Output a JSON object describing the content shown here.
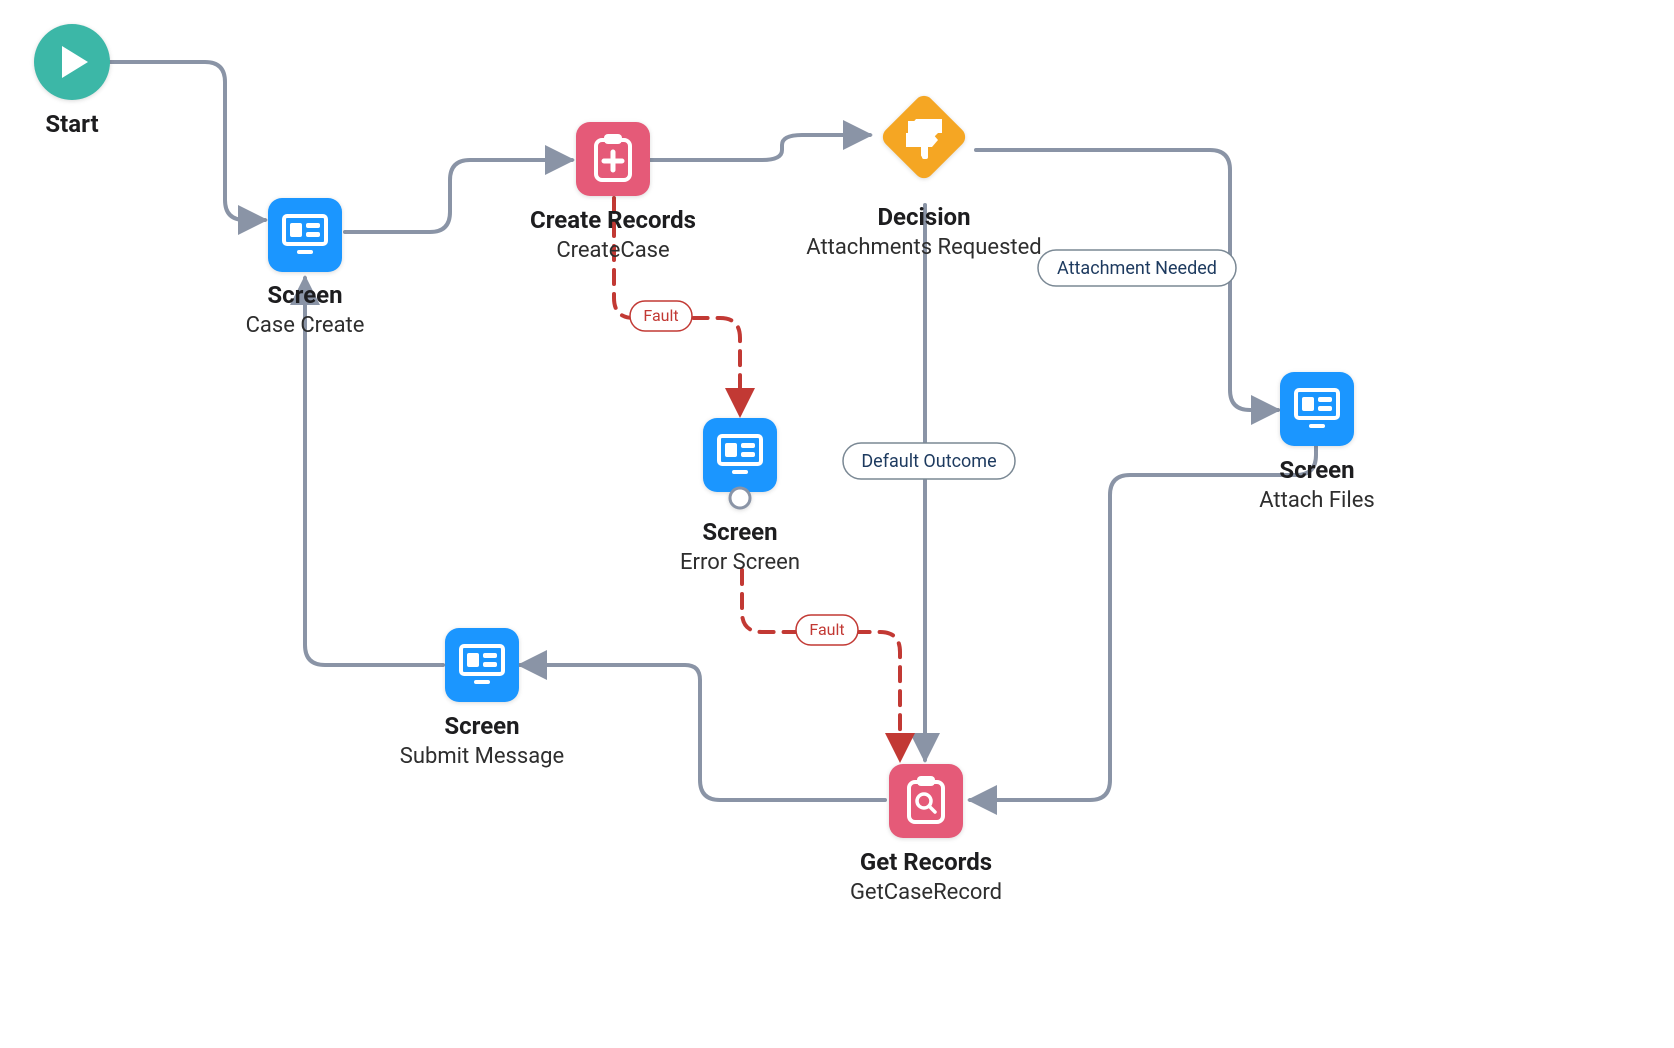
{
  "nodes": {
    "start": {
      "title": "Start"
    },
    "screenCreate": {
      "title": "Screen",
      "subtitle": "Case Create"
    },
    "createRec": {
      "title": "Create Records",
      "subtitle": "CreateCase"
    },
    "decision": {
      "title": "Decision",
      "subtitle": "Attachments Requested"
    },
    "screenAttach": {
      "title": "Screen",
      "subtitle": "Attach Files"
    },
    "screenError": {
      "title": "Screen",
      "subtitle": "Error Screen"
    },
    "getRec": {
      "title": "Get Records",
      "subtitle": "GetCaseRecord"
    },
    "screenSubmit": {
      "title": "Screen",
      "subtitle": "Submit Message"
    }
  },
  "labels": {
    "attachmentNeeded": "Attachment Needed",
    "defaultOutcome": "Default Outcome",
    "fault1": "Fault",
    "fault2": "Fault"
  },
  "colors": {
    "screen": "#1b96ff",
    "create": "#e55a78",
    "decision": "#f5a623",
    "start": "#3cb7a7",
    "connector": "#8a94a6",
    "fault": "#c23934",
    "textDark": "#1d1d1f"
  }
}
